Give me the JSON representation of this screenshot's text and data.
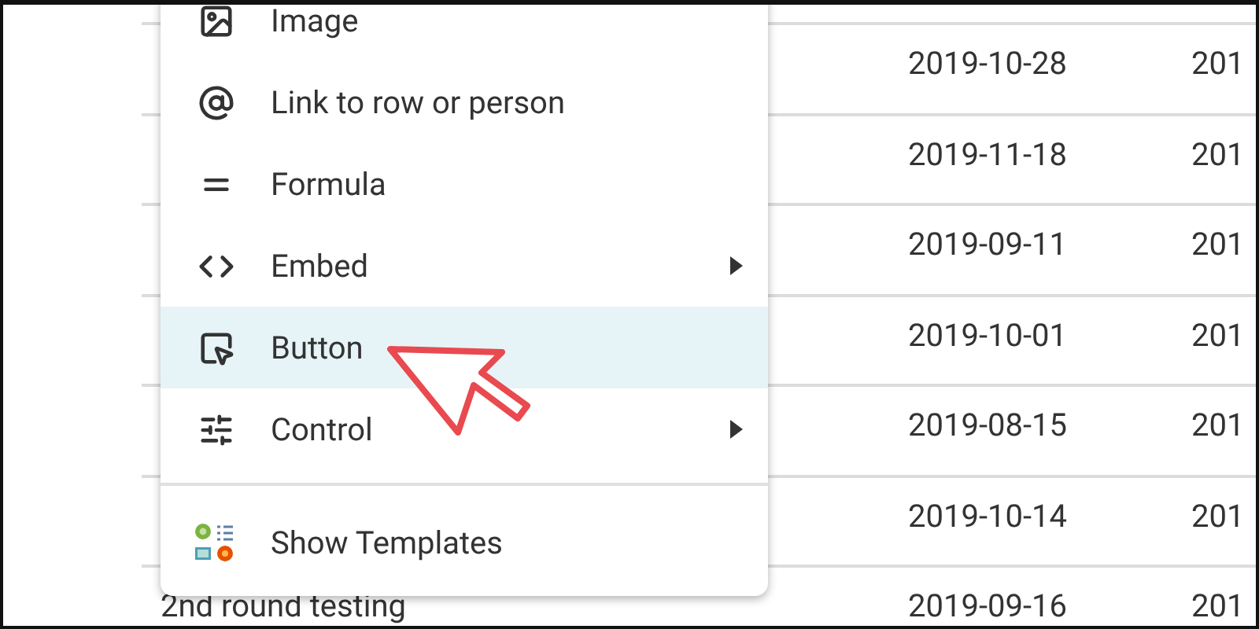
{
  "table": {
    "rows": [
      {
        "column_1": "",
        "date": "2019-10-28",
        "column_3": "201"
      },
      {
        "column_1": "",
        "date": "2019-11-18",
        "column_3": "201"
      },
      {
        "column_1": "",
        "date": "2019-09-11",
        "column_3": "201"
      },
      {
        "column_1": "",
        "date": "2019-10-01",
        "column_3": "201"
      },
      {
        "column_1": "",
        "date": "2019-08-15",
        "column_3": "201"
      },
      {
        "column_1": "",
        "date": "2019-10-14",
        "column_3": "201"
      },
      {
        "column_1": "2nd round testing",
        "date": "2019-09-16",
        "column_3": "201"
      }
    ]
  },
  "menu": {
    "sections": [
      [
        {
          "label": "Image",
          "submenu": false,
          "selected": false
        },
        {
          "label": "Link to row or person",
          "submenu": false,
          "selected": false
        },
        {
          "label": "Formula",
          "submenu": false,
          "selected": false
        },
        {
          "label": "Embed",
          "submenu": true,
          "selected": false
        },
        {
          "label": "Button",
          "submenu": false,
          "selected": true
        },
        {
          "label": "Control",
          "submenu": true,
          "selected": false
        }
      ],
      [
        {
          "label": "Show Templates",
          "submenu": false,
          "selected": false
        }
      ]
    ]
  }
}
